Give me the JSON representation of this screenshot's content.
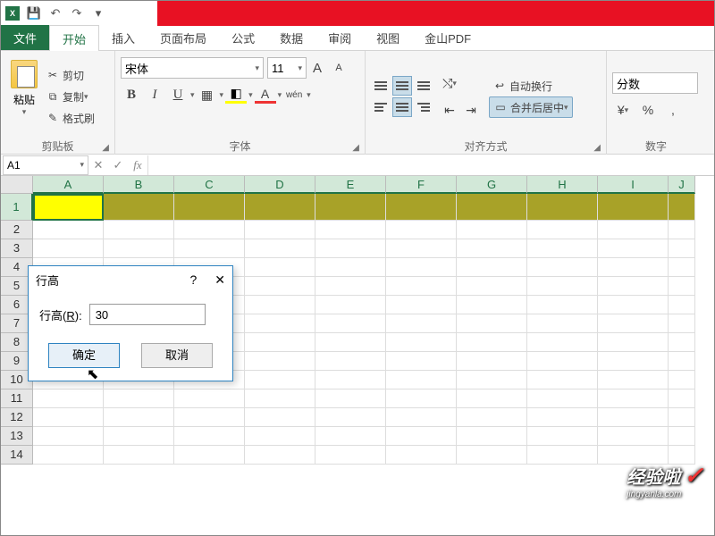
{
  "qat": {
    "excel": "X"
  },
  "tabs": {
    "file": "文件",
    "home": "开始",
    "insert": "插入",
    "layout": "页面布局",
    "formula": "公式",
    "data": "数据",
    "review": "审阅",
    "view": "视图",
    "pdf": "金山PDF"
  },
  "clipboard": {
    "paste": "粘贴",
    "cut": "剪切",
    "copy": "复制",
    "format_painter": "格式刷",
    "label": "剪贴板"
  },
  "font": {
    "name": "宋体",
    "size": "11",
    "grow": "A",
    "shrink": "A",
    "bold": "B",
    "italic": "I",
    "underline": "U",
    "wen": "wén",
    "label": "字体"
  },
  "align": {
    "wrap": "自动换行",
    "merge": "合并后居中",
    "label": "对齐方式"
  },
  "number": {
    "format": "分数",
    "percent": "%",
    "comma": ",",
    "label": "数字"
  },
  "formula_bar": {
    "name_box": "A1",
    "fx": "fx"
  },
  "columns": [
    "A",
    "B",
    "C",
    "D",
    "E",
    "F",
    "G",
    "H",
    "I",
    "J"
  ],
  "rows": [
    "1",
    "2",
    "3",
    "4",
    "5",
    "6",
    "7",
    "8",
    "9",
    "10",
    "11",
    "12",
    "13",
    "14"
  ],
  "dialog": {
    "title": "行高",
    "help": "?",
    "close": "✕",
    "field_label_pre": "行高(",
    "field_label_u": "R",
    "field_label_post": "):",
    "value": "30",
    "ok": "确定",
    "cancel": "取消"
  },
  "watermark": {
    "main": "经验啦",
    "check": "✓",
    "sub": "jingyanla.com"
  }
}
